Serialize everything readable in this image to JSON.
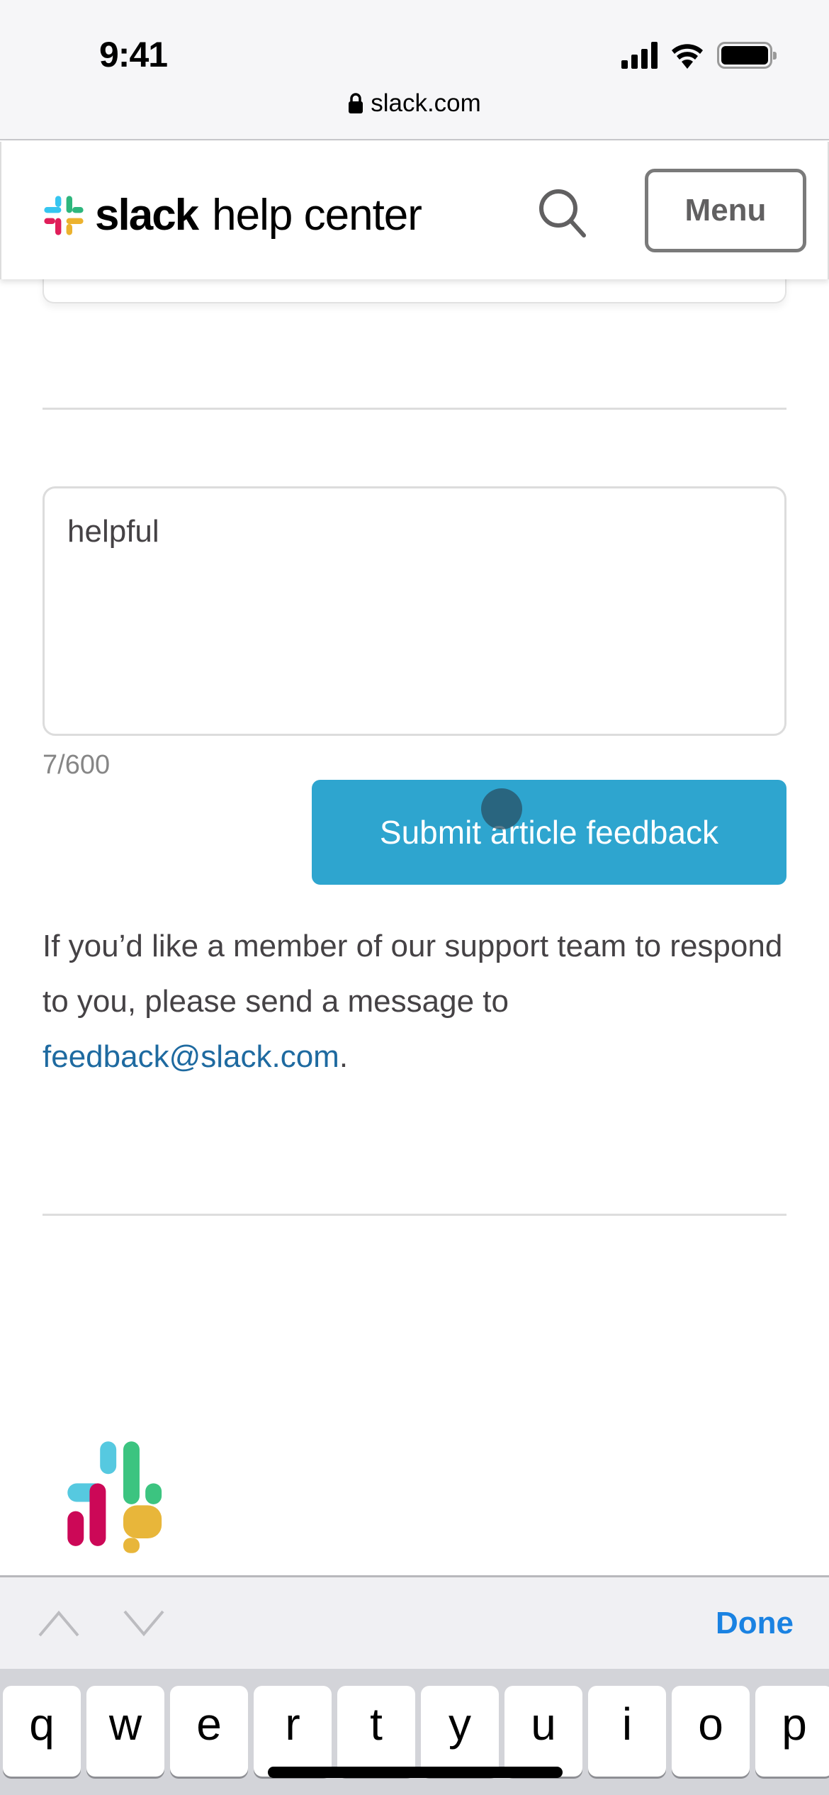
{
  "status_bar": {
    "time": "9:41",
    "icons": [
      "cellular-signal-icon",
      "wifi-icon",
      "battery-icon"
    ]
  },
  "browser": {
    "url": "slack.com",
    "lock_icon": "lock-icon"
  },
  "header": {
    "logo_word": "slack",
    "logo_sub": "help center",
    "search_icon": "search-icon",
    "menu_label": "Menu"
  },
  "feedback": {
    "textarea_value": "helpful",
    "char_count": "7/600",
    "submit_label": "Submit article feedback",
    "info_text_before": "If you’d like a member of our support team to respond to you, please send a message to ",
    "email_link": "feedback@slack.com",
    "info_text_after": "."
  },
  "keyboard_accessory": {
    "prev_icon": "chevron-up-icon",
    "next_icon": "chevron-down-icon",
    "done_label": "Done"
  },
  "keyboard": {
    "row1": [
      "q",
      "w",
      "e",
      "r",
      "t",
      "y",
      "u",
      "i",
      "o",
      "p"
    ]
  },
  "colors": {
    "submit_button": "#2ea5cf",
    "link": "#1e6aa0",
    "done": "#1a82e2",
    "slack_blue": "#36c5f0",
    "slack_green": "#2eb67d",
    "slack_red": "#e01e5a",
    "slack_yellow": "#ecb22e"
  }
}
